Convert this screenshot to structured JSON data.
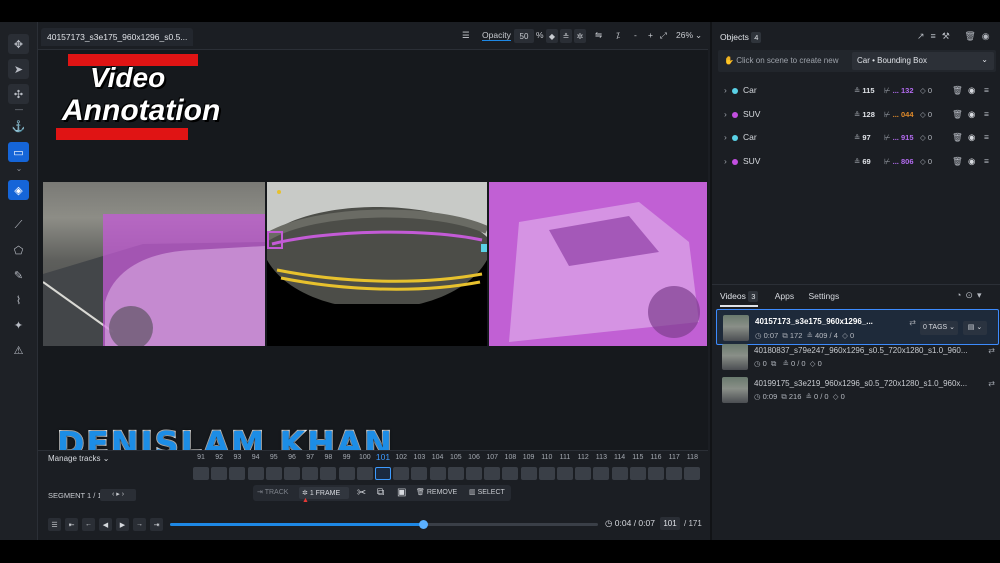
{
  "window": {
    "tab_title": "40157173_s3e175_960x1296_s0.5..."
  },
  "toolbar": {
    "opacity_label": "Opacity",
    "opacity_value": "50",
    "opacity_unit": "%",
    "zoom_value": "26%",
    "zoom_minus": "-",
    "zoom_plus": "+"
  },
  "overlay": {
    "logo_line1": "Video",
    "logo_line2": "Annotation",
    "watermark": "DENISLAM KHAN"
  },
  "objects_panel": {
    "title": "Objects",
    "count": "4",
    "hint": "Click on scene to create new",
    "class_select": "Car • Bounding Box",
    "items": [
      {
        "label": "Car",
        "color": "#5ad1e6",
        "a": "115",
        "b": "... 132",
        "b_color": "#b36bf0",
        "c": "0"
      },
      {
        "label": "SUV",
        "color": "#c34fe0",
        "a": "128",
        "b": "... 044",
        "b_color": "#e08a2a",
        "c": "0"
      },
      {
        "label": "Car",
        "color": "#5ad1e6",
        "a": "97",
        "b": "... 915",
        "b_color": "#b36bf0",
        "c": "0"
      },
      {
        "label": "SUV",
        "color": "#c34fe0",
        "a": "69",
        "b": "... 806",
        "b_color": "#b36bf0",
        "c": "0"
      }
    ]
  },
  "videos_panel": {
    "tabs": [
      "Videos",
      "Apps",
      "Settings"
    ],
    "videos_count": "3",
    "items": [
      {
        "name": "40157173_s3e175_960x1296_...",
        "duration": "0:07",
        "frames": "172",
        "objects": "409 / 4",
        "tags": "0",
        "tag_button": "0 TAGS"
      },
      {
        "name": "40180837_s79e247_960x1296_s0.5_720x1280_s1.0_960...",
        "duration": "0",
        "frames": "",
        "objects": "0 / 0",
        "tags": "0"
      },
      {
        "name": "40199175_s3e219_960x1296_s0.5_720x1280_s1.0_960x...",
        "duration": "0:09",
        "frames": "216",
        "objects": "0 / 0",
        "tags": "0"
      }
    ]
  },
  "timeline": {
    "manage_tracks": "Manage tracks",
    "segment": "SEGMENT 1 / 1",
    "frame_numbers": [
      "91",
      "92",
      "93",
      "94",
      "95",
      "96",
      "97",
      "98",
      "99",
      "100",
      "101",
      "102",
      "103",
      "104",
      "105",
      "106",
      "107",
      "108",
      "109",
      "110",
      "111",
      "112",
      "113",
      "114",
      "115",
      "116",
      "117",
      "118"
    ],
    "current_frame_label": "101",
    "actions": {
      "track": "TRACK",
      "frame": "1 FRAME",
      "remove": "REMOVE",
      "select": "SELECT"
    }
  },
  "playback": {
    "time": "0:04 / 0:07",
    "frame": "101",
    "total_frames": "/ 171",
    "progress": 0.59
  },
  "colors": {
    "accent": "#1565d8",
    "mask_purple": "#c35bd6",
    "logo_red": "#e01414"
  }
}
